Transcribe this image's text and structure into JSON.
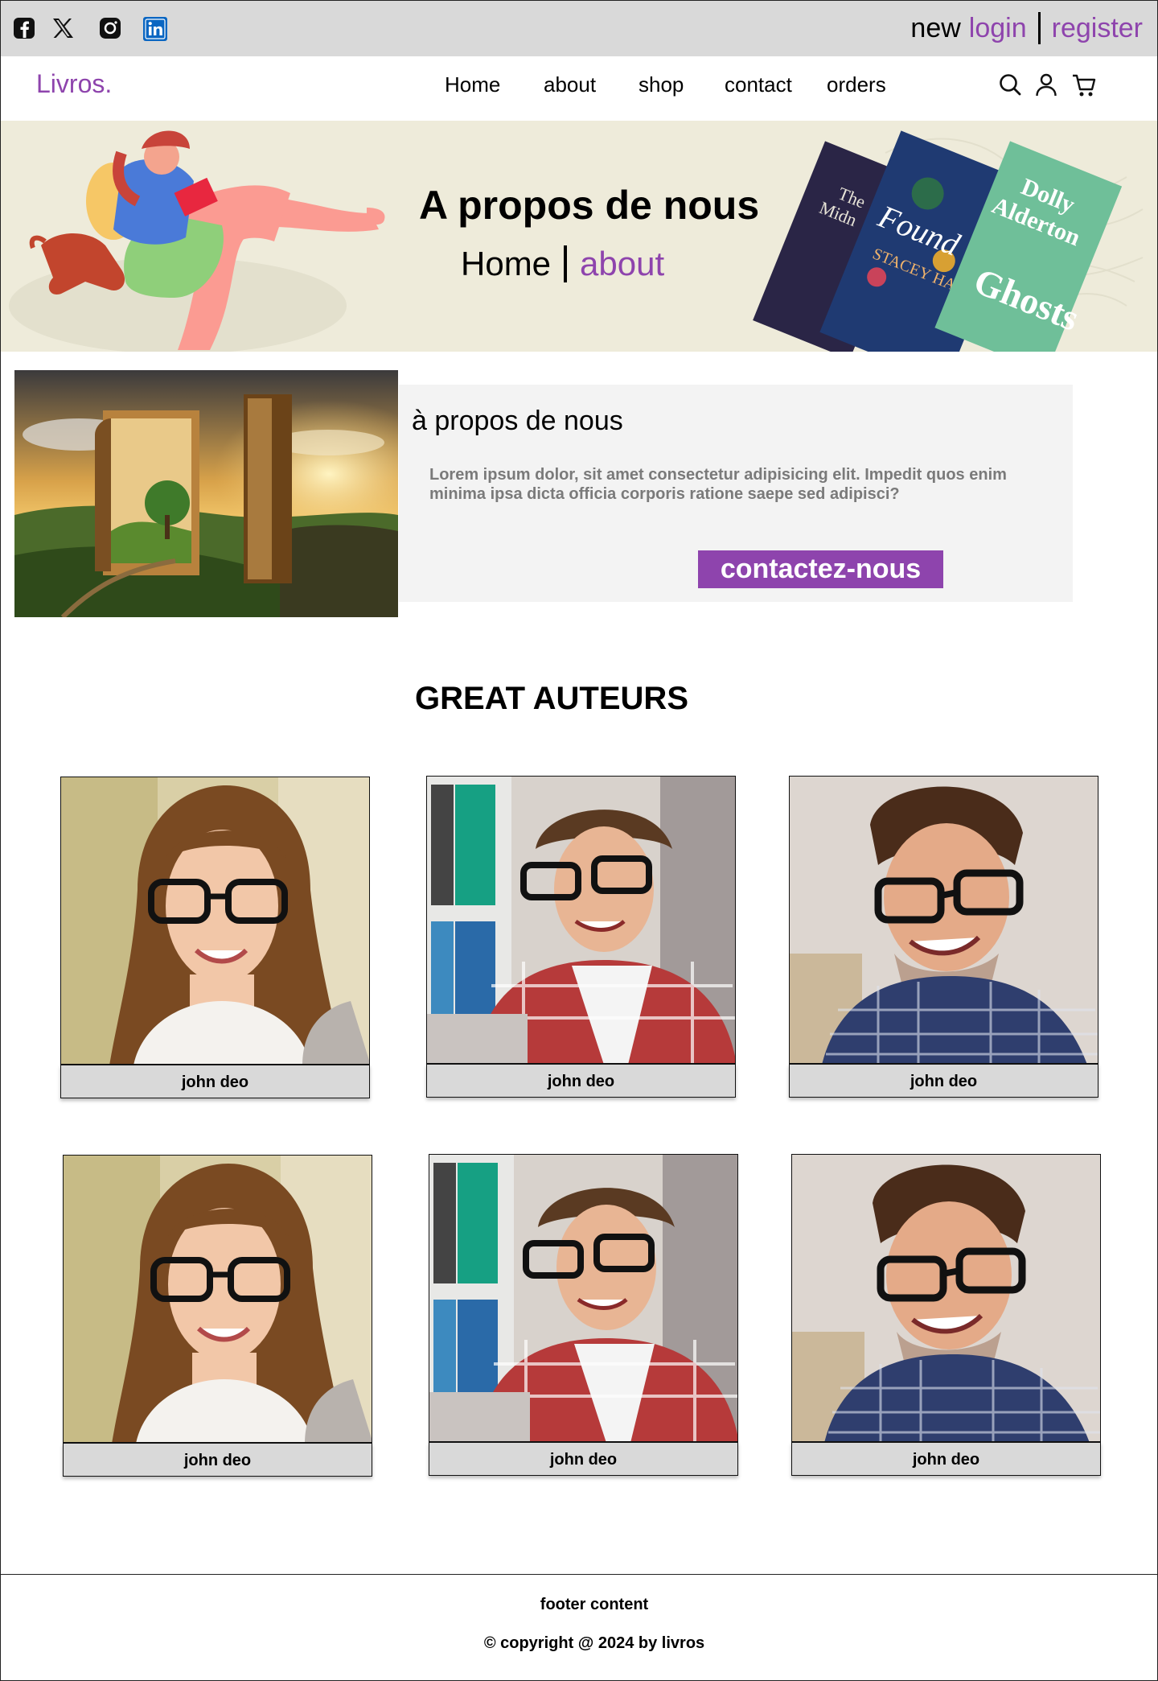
{
  "topbar": {
    "social": [
      {
        "name": "facebook-icon"
      },
      {
        "name": "x-twitter-icon"
      },
      {
        "name": "instagram-icon"
      },
      {
        "name": "linkedin-icon"
      }
    ],
    "new_label": "new",
    "login_label": "login",
    "register_label": "register",
    "accent": "#8e44ad"
  },
  "header": {
    "logo": "Livros.",
    "nav": [
      "Home",
      "about",
      "shop",
      "contact",
      "orders"
    ],
    "icons": [
      "search-icon",
      "user-icon",
      "cart-icon"
    ]
  },
  "banner": {
    "title": "A propos de nous",
    "crumb_home": "Home",
    "crumb_current": "about"
  },
  "about": {
    "title": "à propos de nous",
    "text": "Lorem ipsum dolor, sit amet consectetur adipisicing elit. Impedit quos enim minima ipsa dicta officia corporis ratione saepe sed adipisci?",
    "button": "contactez-nous"
  },
  "authors": {
    "title": "GREAT AUTEURS",
    "items": [
      {
        "name": "john deo",
        "photo": "woman-glasses"
      },
      {
        "name": "john deo",
        "photo": "man-laptop"
      },
      {
        "name": "john deo",
        "photo": "man-checked-shirt"
      },
      {
        "name": "john deo",
        "photo": "woman-glasses"
      },
      {
        "name": "john deo",
        "photo": "man-laptop"
      },
      {
        "name": "john deo",
        "photo": "man-checked-shirt"
      }
    ]
  },
  "footer": {
    "content": "footer content",
    "copyright": "© copyright @ 2024 by livros"
  }
}
